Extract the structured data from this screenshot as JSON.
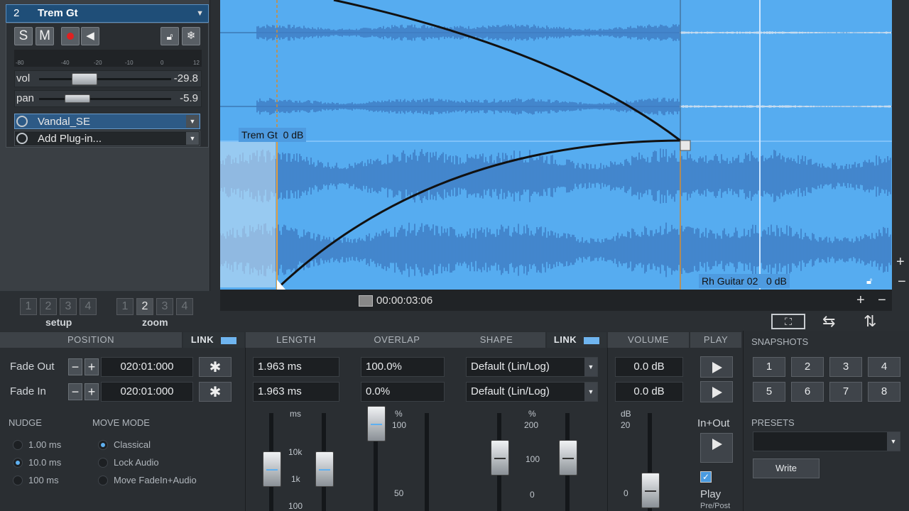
{
  "track": {
    "number": "2",
    "name": "Trem Gt",
    "buttons": {
      "solo": "S",
      "mute": "M"
    },
    "meter_ticks": [
      "-80",
      "-40",
      "-20",
      "-10",
      "0",
      "12"
    ],
    "vol_label": "vol",
    "vol_value": "-29.8",
    "pan_label": "pan",
    "pan_value": "-5.9",
    "plugins": [
      "Vandal_SE",
      "Add Plug-in..."
    ]
  },
  "setup": {
    "label": "setup",
    "items": [
      "1",
      "2",
      "3",
      "4"
    ]
  },
  "zoom": {
    "label": "zoom",
    "items": [
      "1",
      "2",
      "3",
      "4"
    ],
    "selected": 1
  },
  "clips": {
    "top_label": "Trem Gt",
    "top_gain": "0 dB",
    "bottom_label": "Rh Guitar 02",
    "bottom_gain": "0 dB"
  },
  "transport": {
    "time": "00:00:03:06"
  },
  "right_strip": {
    "plus": "+",
    "minus": "−"
  },
  "zoom_controls": {
    "plus": "+",
    "minus": "−"
  },
  "panel": {
    "headers": {
      "position": "POSITION",
      "link1": "LINK",
      "length": "LENGTH",
      "overlap": "OVERLAP",
      "shape": "SHAPE",
      "link2": "LINK",
      "volume": "VOLUME",
      "play": "PLAY",
      "snapshots": "SNAPSHOTS"
    },
    "fade_out": {
      "label": "Fade Out",
      "position": "020:01:000",
      "length": "1.963 ms",
      "overlap": "100.0%",
      "shape": "Default  (Lin/Log)",
      "volume": "0.0 dB"
    },
    "fade_in": {
      "label": "Fade In",
      "position": "020:01:000",
      "length": "1.963 ms",
      "overlap": "0.0%",
      "shape": "Default  (Lin/Log)",
      "volume": "0.0 dB"
    },
    "nudge": {
      "title": "NUDGE",
      "options": [
        "1.00 ms",
        "10.0 ms",
        "100 ms"
      ],
      "selected": 1
    },
    "move_mode": {
      "title": "MOVE MODE",
      "options": [
        "Classical",
        "Lock Audio",
        "Move FadeIn+Audio"
      ],
      "selected": 0
    },
    "length_ticks": {
      "unit": "ms",
      "t1": "10k",
      "t2": "1k",
      "t3": "100"
    },
    "overlap_ticks": {
      "unit": "%",
      "t1": "100",
      "t2": "50"
    },
    "shape_ticks": {
      "unit": "%",
      "t1": "200",
      "t2": "100",
      "t3": "0"
    },
    "volume_ticks": {
      "unit": "dB",
      "t1": "20",
      "t2": "0"
    },
    "inout_label": "In+Out",
    "play_label": "Play",
    "prepost_label": "Pre/Post",
    "snapshots": [
      "1",
      "2",
      "3",
      "4",
      "5",
      "6",
      "7",
      "8"
    ],
    "presets_title": "PRESETS",
    "write_label": "Write"
  },
  "colors": {
    "wave_bg": "#56acf0",
    "wave": "#3f7cc4",
    "accent": "#5fb0f0"
  }
}
